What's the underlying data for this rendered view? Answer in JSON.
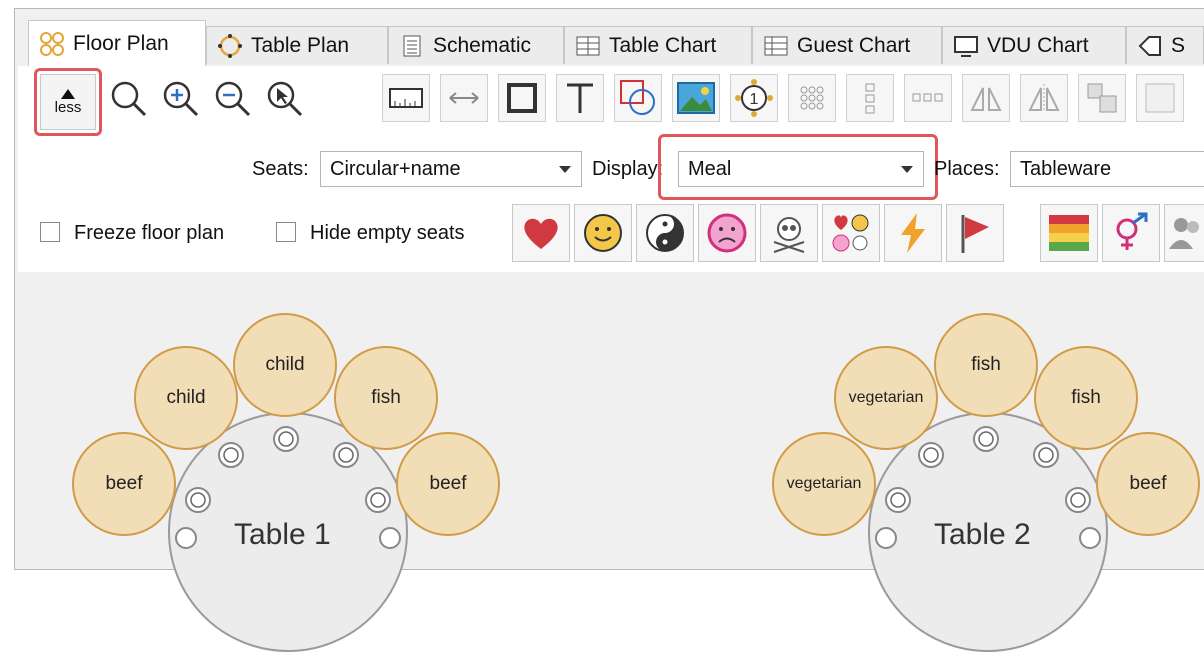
{
  "tabs": [
    {
      "label": "Floor Plan",
      "icon": "floor-plan-icon",
      "active": true
    },
    {
      "label": "Table Plan",
      "icon": "table-plan-icon"
    },
    {
      "label": "Schematic",
      "icon": "schematic-icon"
    },
    {
      "label": "Table Chart",
      "icon": "table-chart-icon"
    },
    {
      "label": "Guest Chart",
      "icon": "guest-chart-icon"
    },
    {
      "label": "VDU Chart",
      "icon": "vdu-chart-icon"
    },
    {
      "label": "S",
      "icon": "tag-icon"
    }
  ],
  "toolbar": {
    "less_label": "less"
  },
  "options": {
    "seats_label": "Seats:",
    "seats_value": "Circular+name",
    "display_label": "Display:",
    "display_value": "Meal",
    "places_label": "Places:",
    "places_value": "Tableware",
    "freeze_label": "Freeze floor plan",
    "hide_empty_label": "Hide empty seats"
  },
  "colors": {
    "highlight": "#e0575a",
    "seat_fill": "#f2deb6",
    "seat_border": "#d29b47"
  },
  "floor": {
    "table1": {
      "name": "Table 1",
      "seats": [
        "beef",
        "child",
        "child",
        "fish",
        "beef"
      ]
    },
    "table2": {
      "name": "Table 2",
      "seats": [
        "vegetarian",
        "vegetarian",
        "fish",
        "fish",
        "beef"
      ]
    }
  }
}
